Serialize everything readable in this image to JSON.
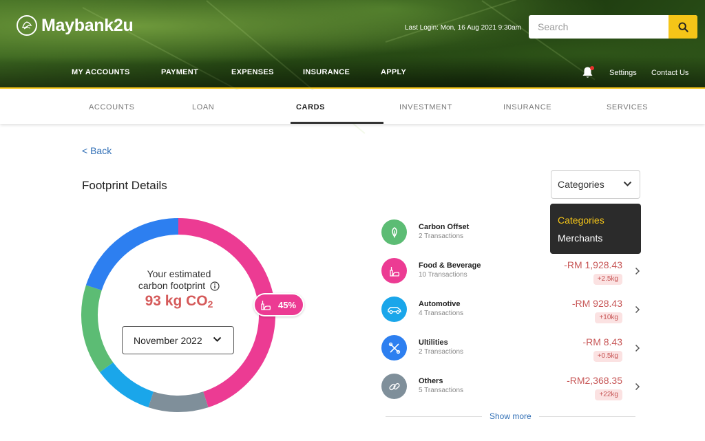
{
  "header": {
    "brand": "Maybank2u",
    "last_login": "Last Login: Mon, 16 Aug 2021 9:30am",
    "search_placeholder": "Search",
    "nav": [
      "MY ACCOUNTS",
      "PAYMENT",
      "EXPENSES",
      "INSURANCE",
      "APPLY"
    ],
    "settings": "Settings",
    "contact": "Contact Us"
  },
  "subnav": {
    "tabs": [
      "ACCOUNTS",
      "LOAN",
      "CARDS",
      "INVESTMENT",
      "INSURANCE",
      "SERVICES"
    ],
    "active": "CARDS"
  },
  "page": {
    "back": "< Back",
    "title": "Footprint Details"
  },
  "filter": {
    "selected": "Categories",
    "options": [
      "Categories",
      "Merchants"
    ]
  },
  "footprint": {
    "estimate_line1": "Your estimated",
    "estimate_line2": "carbon footprint",
    "value": "93 kg CO",
    "value_sub": "2",
    "month": "November 2022",
    "highlight_percent": "45%"
  },
  "chart_data": {
    "type": "pie",
    "segments": [
      {
        "label": "Food & Beverage",
        "value": 45,
        "color": "#ec3b93"
      },
      {
        "label": "Others",
        "value": 10,
        "color": "#7f8f9a"
      },
      {
        "label": "Automotive",
        "value": 10,
        "color": "#1aa6ea"
      },
      {
        "label": "Utilities",
        "value": 15,
        "color": "#5cbc74"
      },
      {
        "label": "Carbon Offset",
        "value": 20,
        "color": "#2d7ff0"
      }
    ]
  },
  "categories": [
    {
      "name": "Carbon Offset",
      "transactions": "2 Transactions",
      "amount": "",
      "badge": "",
      "color": "#5cbc74",
      "icon": "leaf-icon"
    },
    {
      "name": "Food & Beverage",
      "transactions": "10 Transactions",
      "amount": "-RM 1,928.43",
      "badge": "+2.5kg",
      "color": "#ec3b93",
      "icon": "food-icon"
    },
    {
      "name": "Automotive",
      "transactions": "4 Transactions",
      "amount": "-RM 928.43",
      "badge": "+10kg",
      "color": "#1aa6ea",
      "icon": "car-icon"
    },
    {
      "name": "Ultilities",
      "transactions": "2 Transactions",
      "amount": "-RM 8.43",
      "badge": "+0.5kg",
      "color": "#2d7ff0",
      "icon": "tools-icon"
    },
    {
      "name": "Others",
      "transactions": "5 Transactions",
      "amount": "-RM2,368.35",
      "badge": "+22kg",
      "color": "#7f8f9a",
      "icon": "link-icon"
    }
  ],
  "show_more": "Show more"
}
